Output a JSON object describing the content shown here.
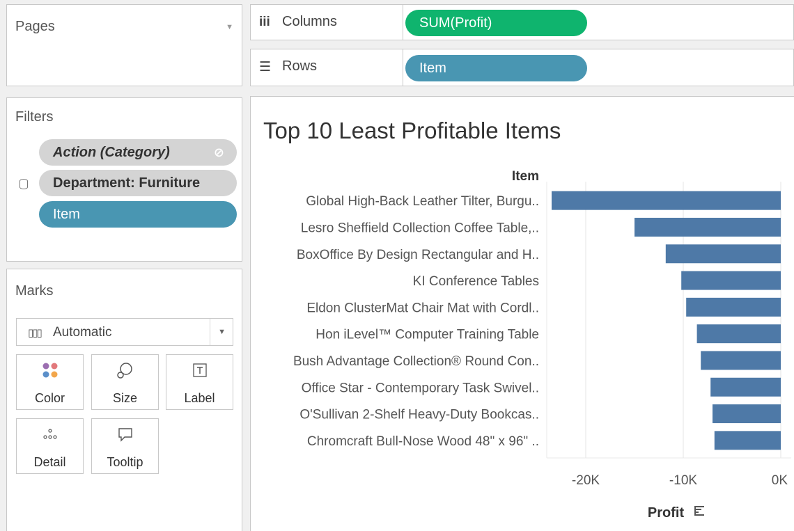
{
  "pages": {
    "title": "Pages"
  },
  "filters": {
    "title": "Filters",
    "items": [
      {
        "label": "Action (Category)"
      },
      {
        "label": "Department: Furniture"
      },
      {
        "label": "Item"
      }
    ]
  },
  "marks": {
    "title": "Marks",
    "type": "Automatic",
    "cards": [
      {
        "label": "Color"
      },
      {
        "label": "Size"
      },
      {
        "label": "Label"
      },
      {
        "label": "Detail"
      },
      {
        "label": "Tooltip"
      }
    ]
  },
  "shelves": {
    "columns": {
      "label": "Columns",
      "pill": "SUM(Profit)"
    },
    "rows": {
      "label": "Rows",
      "pill": "Item"
    }
  },
  "view": {
    "title": "Top 10 Least Profitable Items"
  },
  "colors": {
    "bar": "#4e79a7",
    "pill_green": "#0fb46e",
    "pill_blue": "#4996b2"
  },
  "chart_data": {
    "type": "bar",
    "orientation": "horizontal",
    "title": "Top 10 Least Profitable Items",
    "ylabel": "Item",
    "xlabel": "Profit",
    "xlim": [
      -24000,
      500
    ],
    "xticks": [
      -20000,
      -10000,
      0
    ],
    "xtick_labels": [
      "-20K",
      "-10K",
      "0K"
    ],
    "categories": [
      "Global High-Back Leather Tilter, Burgu..",
      "Lesro Sheffield Collection Coffee Table,..",
      "BoxOffice By Design Rectangular and H..",
      "KI Conference Tables",
      "Eldon ClusterMat Chair Mat with Cordl..",
      "Hon iLevel™ Computer Training Table",
      "Bush Advantage Collection® Round Con..",
      "Office Star - Contemporary Task Swivel..",
      "O'Sullivan 2-Shelf Heavy-Duty Bookcas..",
      "Chromcraft Bull-Nose Wood 48\" x 96\" .."
    ],
    "values": [
      -23500,
      -15000,
      -11800,
      -10200,
      -9700,
      -8600,
      -8200,
      -7200,
      -7000,
      -6800
    ],
    "grid": true
  }
}
